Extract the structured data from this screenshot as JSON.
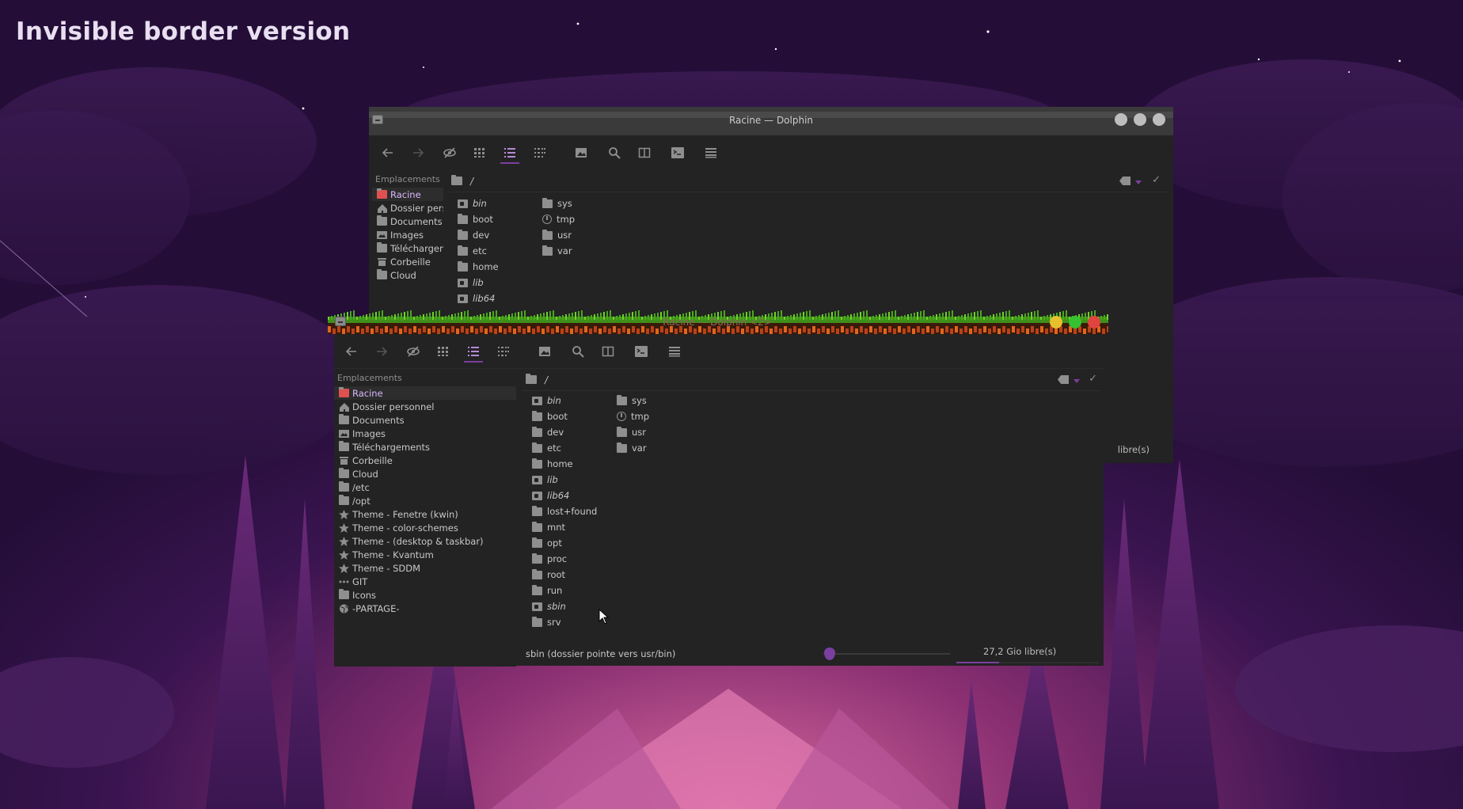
{
  "headline": "Invisible border version",
  "colors": {
    "accent": "#7b3fa0",
    "active_place_icon": "#e05050",
    "active_place_text": "#d9b8ff",
    "close": "#e0443e",
    "maximize": "#36c230",
    "minimize": "#e8c02e",
    "inactive_button": "#bdbdbd",
    "window_bg": "#232323"
  },
  "back_window": {
    "title": "Racine — Dolphin",
    "toolbar": [
      {
        "name": "back-icon"
      },
      {
        "name": "forward-icon"
      },
      {
        "name": "hidden-files-icon"
      },
      {
        "name": "icons-view-icon"
      },
      {
        "name": "details-view-icon",
        "active": true
      },
      {
        "name": "compact-view-icon"
      },
      {
        "name": "preview-icon"
      },
      {
        "name": "search-icon"
      },
      {
        "name": "split-view-icon"
      },
      {
        "name": "terminal-icon"
      },
      {
        "name": "hamburger-menu-icon"
      }
    ],
    "places_heading": "Emplacements",
    "places": [
      {
        "label": "Racine",
        "icon": "folder",
        "active": true
      },
      {
        "label": "Dossier pers",
        "icon": "home"
      },
      {
        "label": "Documents",
        "icon": "folder"
      },
      {
        "label": "Images",
        "icon": "image"
      },
      {
        "label": "Téléchargen",
        "icon": "folder"
      },
      {
        "label": "Corbeille",
        "icon": "trash"
      },
      {
        "label": "Cloud",
        "icon": "folder"
      }
    ],
    "path": "/",
    "files_col1": [
      {
        "label": "bin",
        "link": true
      },
      {
        "label": "boot"
      },
      {
        "label": "dev"
      },
      {
        "label": "etc"
      },
      {
        "label": "home"
      },
      {
        "label": "lib",
        "link": true
      },
      {
        "label": "lib64",
        "link": true
      }
    ],
    "files_col2": [
      {
        "label": "sys"
      },
      {
        "label": "tmp",
        "clock": true
      },
      {
        "label": "usr"
      },
      {
        "label": "var"
      }
    ],
    "free_space": "libre(s)"
  },
  "front_window": {
    "title": "Racine — Dolphin <2>",
    "toolbar": [
      {
        "name": "back-icon"
      },
      {
        "name": "forward-icon"
      },
      {
        "name": "hidden-files-icon"
      },
      {
        "name": "icons-view-icon"
      },
      {
        "name": "details-view-icon",
        "active": true
      },
      {
        "name": "compact-view-icon"
      },
      {
        "name": "preview-icon"
      },
      {
        "name": "search-icon"
      },
      {
        "name": "split-view-icon"
      },
      {
        "name": "terminal-icon"
      },
      {
        "name": "hamburger-menu-icon"
      }
    ],
    "places_heading": "Emplacements",
    "places": [
      {
        "label": "Racine",
        "icon": "folder",
        "active": true
      },
      {
        "label": "Dossier personnel",
        "icon": "home"
      },
      {
        "label": "Documents",
        "icon": "folder"
      },
      {
        "label": "Images",
        "icon": "image"
      },
      {
        "label": "Téléchargements",
        "icon": "folder"
      },
      {
        "label": "Corbeille",
        "icon": "trash"
      },
      {
        "label": "Cloud",
        "icon": "folder"
      },
      {
        "label": "/etc",
        "icon": "folder"
      },
      {
        "label": "/opt",
        "icon": "folder"
      },
      {
        "label": "Theme - Fenetre (kwin)",
        "icon": "star"
      },
      {
        "label": "Theme - color-schemes",
        "icon": "star"
      },
      {
        "label": "Theme - (desktop & taskbar)",
        "icon": "star"
      },
      {
        "label": "Theme - Kvantum",
        "icon": "star"
      },
      {
        "label": "Theme - SDDM",
        "icon": "star"
      },
      {
        "label": "GIT",
        "icon": "dots"
      },
      {
        "label": "Icons",
        "icon": "folder"
      },
      {
        "label": "-PARTAGE-",
        "icon": "globe"
      }
    ],
    "path": "/",
    "files_col1": [
      {
        "label": "bin",
        "link": true
      },
      {
        "label": "boot"
      },
      {
        "label": "dev"
      },
      {
        "label": "etc"
      },
      {
        "label": "home"
      },
      {
        "label": "lib",
        "link": true
      },
      {
        "label": "lib64",
        "link": true
      },
      {
        "label": "lost+found"
      },
      {
        "label": "mnt"
      },
      {
        "label": "opt"
      },
      {
        "label": "proc"
      },
      {
        "label": "root"
      },
      {
        "label": "run"
      },
      {
        "label": "sbin",
        "link": true
      },
      {
        "label": "srv"
      }
    ],
    "files_col2": [
      {
        "label": "sys"
      },
      {
        "label": "tmp",
        "clock": true
      },
      {
        "label": "usr"
      },
      {
        "label": "var"
      }
    ],
    "status": "sbin (dossier pointe vers usr/bin)",
    "zoom_level": 0.05,
    "free_space": "27,2 Gio libre(s)",
    "disk_used_fraction": 0.3
  }
}
